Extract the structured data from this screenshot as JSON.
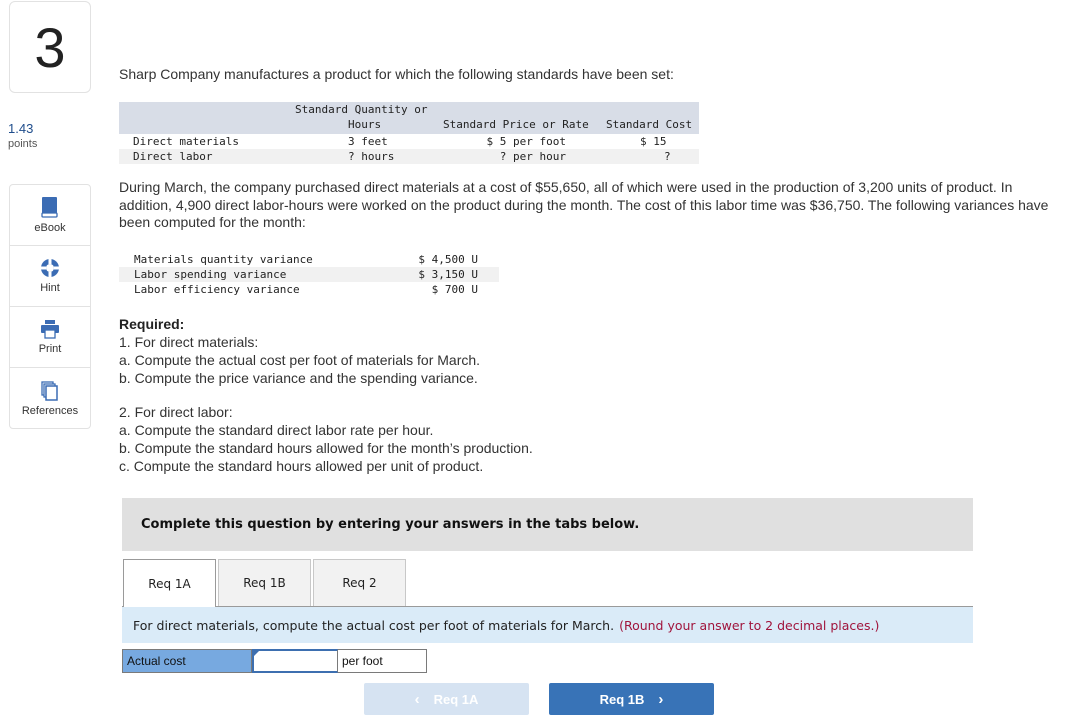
{
  "question": {
    "number": "3",
    "points_value": "1.43",
    "points_label": "points"
  },
  "tools": [
    {
      "icon": "book-icon",
      "label": "eBook"
    },
    {
      "icon": "lifebuoy-icon",
      "label": "Hint"
    },
    {
      "icon": "printer-icon",
      "label": "Print"
    },
    {
      "icon": "copy-icon",
      "label": "References"
    }
  ],
  "intro": "Sharp Company manufactures a product for which the following standards have been set:",
  "standards_table": {
    "headers": {
      "quantity_line1": "Standard Quantity or",
      "quantity_line2": "Hours",
      "price": "Standard Price or Rate",
      "cost": "Standard Cost"
    },
    "rows": [
      {
        "item": "Direct materials",
        "quantity": "3 feet",
        "price": "$ 5 per foot",
        "cost": "$ 15"
      },
      {
        "item": "Direct labor",
        "quantity": "? hours",
        "price": "? per hour",
        "cost": "?"
      }
    ]
  },
  "paragraph": "During March, the company purchased direct materials at a cost of $55,650, all of which were used in the production of 3,200 units of product. In addition, 4,900 direct labor-hours were worked on the product during the month. The cost of this labor time was $36,750. The following variances have been computed for the month:",
  "variances": [
    {
      "label": "Materials quantity variance",
      "value": "$ 4,500 U"
    },
    {
      "label": "Labor spending variance",
      "value": "$ 3,150 U"
    },
    {
      "label": "Labor efficiency variance",
      "value": "$ 700 U"
    }
  ],
  "required": {
    "heading": "Required:",
    "part1": "1. For direct materials:",
    "part1a": "a. Compute the actual cost per foot of materials for March.",
    "part1b": "b. Compute the price variance and the spending variance.",
    "part2": "2. For direct labor:",
    "part2a": "a. Compute the standard direct labor rate per hour.",
    "part2b": "b. Compute the standard hours allowed for the month’s production.",
    "part2c": "c. Compute the standard hours allowed per unit of product."
  },
  "banner": "Complete this question by entering your answers in the tabs below.",
  "tabs": [
    {
      "label": "Req 1A",
      "active": true
    },
    {
      "label": "Req 1B",
      "active": false
    },
    {
      "label": "Req 2",
      "active": false
    }
  ],
  "instruction": {
    "text": "For direct materials, compute the actual cost per foot of materials for March.",
    "note": "(Round your answer to 2 decimal places.)"
  },
  "answer": {
    "label": "Actual cost",
    "value": "",
    "unit": "per foot"
  },
  "nav": {
    "prev_label": "Req 1A",
    "next_label": "Req 1B"
  },
  "colors": {
    "accent": "#3873b7",
    "note": "#a0143c",
    "label_cell": "#77a9e0",
    "instruction_bg": "#daebf8"
  }
}
